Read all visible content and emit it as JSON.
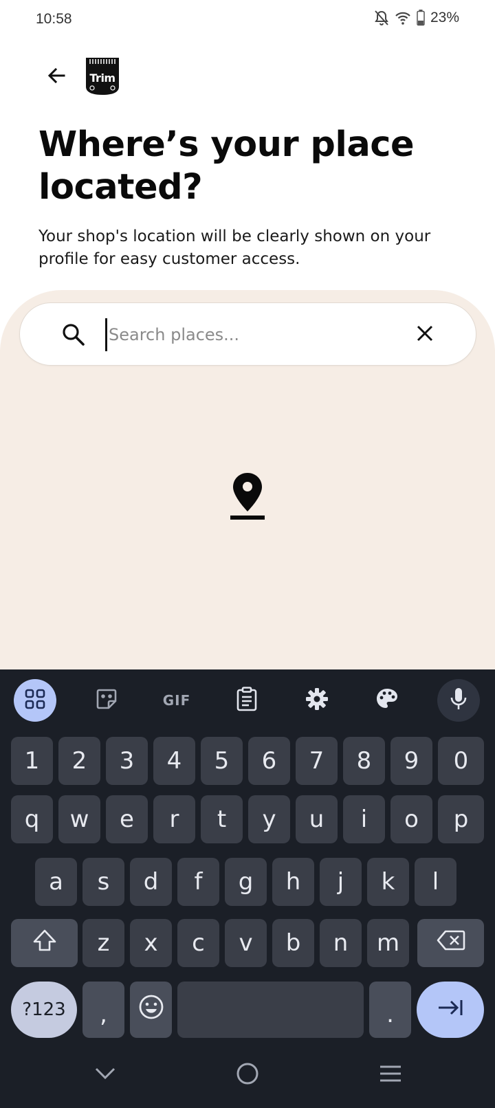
{
  "status": {
    "time": "10:58",
    "battery": "23%",
    "icons": [
      "notifications-off-icon",
      "wifi-icon",
      "battery-icon"
    ]
  },
  "header": {
    "back_icon": "arrow-left-icon",
    "logo_text": "Trim"
  },
  "page": {
    "title": "Where’s your place located?",
    "subtitle": "Your shop's location will be clearly shown on your profile for easy customer access."
  },
  "search": {
    "value": "",
    "placeholder": "Search places...",
    "search_icon": "search-icon",
    "clear_icon": "close-icon"
  },
  "map": {
    "background": "#f6ede5",
    "pin_icon": "location-pin-icon"
  },
  "keyboard": {
    "toolbar": {
      "gif_label": "GIF",
      "icons": [
        "apps-grid-icon",
        "sticker-icon",
        "gif-icon",
        "clipboard-icon",
        "settings-gear-icon",
        "palette-icon",
        "microphone-icon"
      ]
    },
    "row_numbers": [
      "1",
      "2",
      "3",
      "4",
      "5",
      "6",
      "7",
      "8",
      "9",
      "0"
    ],
    "row1": [
      "q",
      "w",
      "e",
      "r",
      "t",
      "y",
      "u",
      "i",
      "o",
      "p"
    ],
    "row2": [
      "a",
      "s",
      "d",
      "f",
      "g",
      "h",
      "j",
      "k",
      "l"
    ],
    "row3": [
      "z",
      "x",
      "c",
      "v",
      "b",
      "n",
      "m"
    ],
    "symbols_label": "?123",
    "comma": ",",
    "period": ".",
    "accent": "#b4c6f8"
  },
  "navbar": {
    "icons": [
      "chevron-down-icon",
      "home-circle-icon",
      "menu-lines-icon"
    ]
  }
}
